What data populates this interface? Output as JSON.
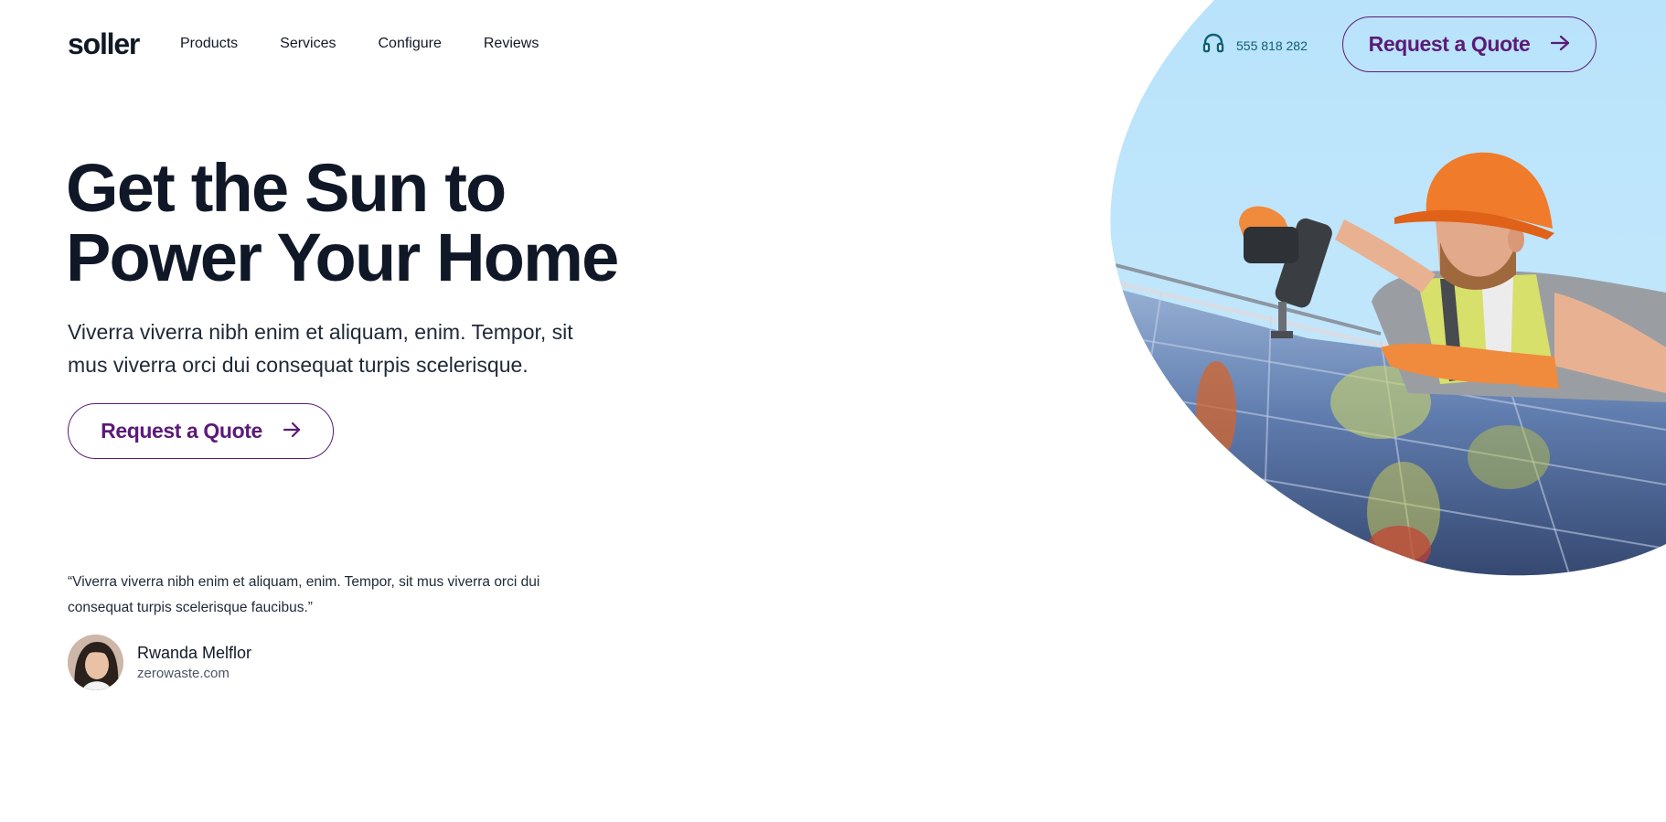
{
  "brand": {
    "logo": "soller"
  },
  "nav": {
    "items": [
      "Products",
      "Services",
      "Configure",
      "Reviews"
    ]
  },
  "header": {
    "phone": "555 818 282",
    "cta_label": "Request a Quote"
  },
  "hero": {
    "headline_line1": "Get the Sun to",
    "headline_line2": "Power Your Home",
    "subtext": "Viverra viverra nibh enim et aliquam, enim. Tempor, sit mus viverra orci dui consequat turpis scelerisque.",
    "cta_label": "Request a Quote"
  },
  "testimonial": {
    "quote": "“Viverra viverra nibh enim et aliquam, enim. Tempor, sit mus viverra orci dui consequat turpis scelerisque faucibus.”",
    "author_name": "Rwanda Melflor",
    "author_site": "zerowaste.com"
  },
  "colors": {
    "accent": "#5b1a78",
    "phone": "#0e5f74",
    "text": "#101828",
    "sky": "#bee6fb"
  },
  "icons": {
    "phone": "headset-icon",
    "cta": "arrow-right-icon"
  }
}
